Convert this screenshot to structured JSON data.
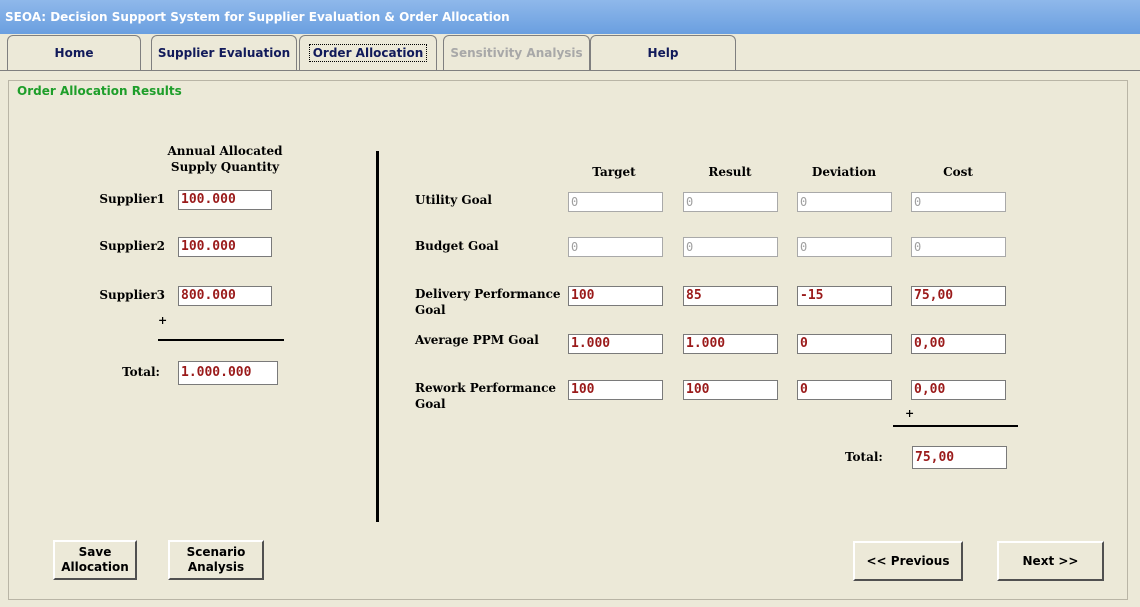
{
  "app": {
    "title": "SEOA: Decision Support System for Supplier Evaluation & Order Allocation"
  },
  "tabs": [
    {
      "label": "Home"
    },
    {
      "label": "Supplier Evaluation"
    },
    {
      "label": "Order Allocation"
    },
    {
      "label": "Sensitivity Analysis"
    },
    {
      "label": "Help"
    }
  ],
  "panel": {
    "legend": "Order Allocation Results"
  },
  "supply": {
    "header_line1": "Annual Allocated",
    "header_line2": "Supply Quantity",
    "rows": [
      {
        "label": "Supplier1",
        "value": "100.000"
      },
      {
        "label": "Supplier2",
        "value": "100.000"
      },
      {
        "label": "Supplier3",
        "value": "800.000"
      }
    ],
    "plus": "+",
    "total_label": "Total:",
    "total_value": "1.000.000"
  },
  "goals": {
    "columns": [
      "Target",
      "Result",
      "Deviation",
      "Cost"
    ],
    "rows": [
      {
        "label1": "Utility Goal",
        "label2": "",
        "values": [
          "0",
          "0",
          "0",
          "0"
        ]
      },
      {
        "label1": "Budget Goal",
        "label2": "",
        "values": [
          "0",
          "0",
          "0",
          "0"
        ]
      },
      {
        "label1": "Delivery Performance",
        "label2": "Goal",
        "values": [
          "100",
          "85",
          "-15",
          "75,00"
        ]
      },
      {
        "label1": "Average PPM Goal",
        "label2": "",
        "values": [
          "1.000",
          "1.000",
          "0",
          "0,00"
        ]
      },
      {
        "label1": "Rework Performance",
        "label2": "Goal",
        "values": [
          "100",
          "100",
          "0",
          "0,00"
        ]
      }
    ],
    "plus": "+",
    "total_label": "Total:",
    "total_value": "75,00"
  },
  "buttons": {
    "save_line1": "Save",
    "save_line2": "Allocation",
    "scenario_line1": "Scenario",
    "scenario_line2": "Analysis",
    "previous": "<< Previous",
    "next": "Next >>"
  }
}
